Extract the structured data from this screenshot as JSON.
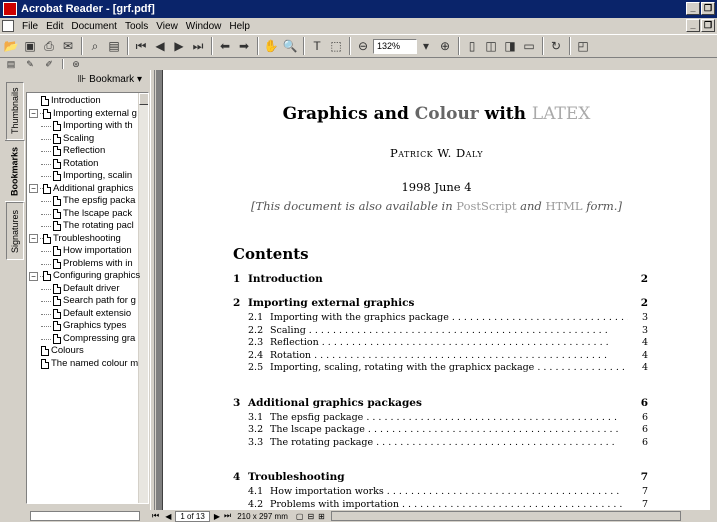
{
  "window": {
    "title": "Acrobat Reader - [grf.pdf]"
  },
  "menu": [
    "File",
    "Edit",
    "Document",
    "Tools",
    "View",
    "Window",
    "Help"
  ],
  "toolbar": {
    "zoom": "132%"
  },
  "nav": {
    "header": "Bookmark",
    "tabs": [
      "Thumbnails",
      "Bookmarks",
      "Signatures"
    ],
    "items": [
      {
        "label": "Introduction",
        "level": 0,
        "expander": ""
      },
      {
        "label": "Importing external g",
        "level": 0,
        "expander": "−"
      },
      {
        "label": "Importing with th",
        "level": 1,
        "expander": ""
      },
      {
        "label": "Scaling",
        "level": 1,
        "expander": ""
      },
      {
        "label": "Reflection",
        "level": 1,
        "expander": ""
      },
      {
        "label": "Rotation",
        "level": 1,
        "expander": ""
      },
      {
        "label": "Importing, scalin",
        "level": 1,
        "expander": ""
      },
      {
        "label": "Additional graphics",
        "level": 0,
        "expander": "−"
      },
      {
        "label": "The epsfig packa",
        "level": 1,
        "expander": ""
      },
      {
        "label": "The lscape pack",
        "level": 1,
        "expander": ""
      },
      {
        "label": "The rotating pacl",
        "level": 1,
        "expander": ""
      },
      {
        "label": "Troubleshooting",
        "level": 0,
        "expander": "−"
      },
      {
        "label": "How importation",
        "level": 1,
        "expander": ""
      },
      {
        "label": "Problems with in",
        "level": 1,
        "expander": ""
      },
      {
        "label": "Configuring graphics",
        "level": 0,
        "expander": "−"
      },
      {
        "label": "Default driver",
        "level": 1,
        "expander": ""
      },
      {
        "label": "Search path for g",
        "level": 1,
        "expander": ""
      },
      {
        "label": "Default extensio",
        "level": 1,
        "expander": ""
      },
      {
        "label": "Graphics types",
        "level": 1,
        "expander": ""
      },
      {
        "label": "Compressing gra",
        "level": 1,
        "expander": ""
      },
      {
        "label": "Colours",
        "level": 0,
        "expander": ""
      },
      {
        "label": "The named colour m",
        "level": 0,
        "expander": ""
      }
    ]
  },
  "doc": {
    "title_a": "Graphics and ",
    "title_b": "Colour",
    "title_c": " with ",
    "title_latex": "LATEX",
    "author": "Patrick W. Daly",
    "date": "1998 June 4",
    "avail_a": "[This document is also available in ",
    "avail_ps": "PostScript",
    "avail_and": " and ",
    "avail_html": "HTML",
    "avail_b": " form.]",
    "contents": "Contents",
    "toc": [
      {
        "num": "1",
        "title": "Introduction",
        "page": "2",
        "subs": []
      },
      {
        "num": "2",
        "title": "Importing external graphics",
        "page": "2",
        "subs": [
          {
            "num": "2.1",
            "title": "Importing with the graphics package . . . . . . . . . . . . . . . . . . . . . . . . . . . . . . .",
            "page": "3"
          },
          {
            "num": "2.2",
            "title": "Scaling . . . . . . . . . . . . . . . . . . . . . . . . . . . . . . . . . . . . . . . . . . . . . . . . . .",
            "page": "3"
          },
          {
            "num": "2.3",
            "title": "Reflection . . . . . . . . . . . . . . . . . . . . . . . . . . . . . . . . . . . . . . . . . . . . . . . .",
            "page": "4"
          },
          {
            "num": "2.4",
            "title": "Rotation . . . . . . . . . . . . . . . . . . . . . . . . . . . . . . . . . . . . . . . . . . . . . . . . .",
            "page": "4"
          },
          {
            "num": "2.5",
            "title": "Importing, scaling, rotating with the graphicx package . . . . . . . . . . . . . . . . . .",
            "page": "4"
          }
        ]
      },
      {
        "num": "3",
        "title": "Additional graphics packages",
        "page": "6",
        "subs": [
          {
            "num": "3.1",
            "title": "The epsfig package . . . . . . . . . . . . . . . . . . . . . . . . . . . . . . . . . . . . . . . . . .",
            "page": "6"
          },
          {
            "num": "3.2",
            "title": "The lscape package . . . . . . . . . . . . . . . . . . . . . . . . . . . . . . . . . . . . . . . . . .",
            "page": "6"
          },
          {
            "num": "3.3",
            "title": "The rotating package . . . . . . . . . . . . . . . . . . . . . . . . . . . . . . . . . . . . . . . .",
            "page": "6"
          }
        ]
      },
      {
        "num": "4",
        "title": "Troubleshooting",
        "page": "7",
        "subs": [
          {
            "num": "4.1",
            "title": "How importation works . . . . . . . . . . . . . . . . . . . . . . . . . . . . . . . . . . . . . . .",
            "page": "7"
          },
          {
            "num": "4.2",
            "title": "Problems with importation . . . . . . . . . . . . . . . . . . . . . . . . . . . . . . . . . . . . .",
            "page": "7"
          }
        ]
      }
    ]
  },
  "status": {
    "page": "1 of 13",
    "size": "210 x 297 mm"
  }
}
